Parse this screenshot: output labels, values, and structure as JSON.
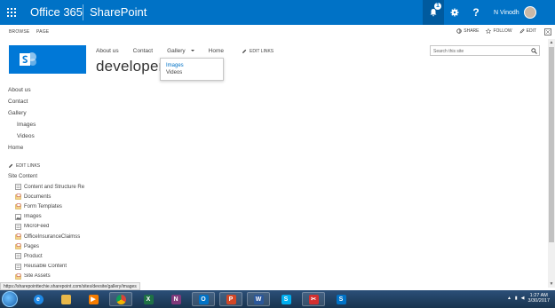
{
  "suitebar": {
    "brand": "Office 365",
    "app": "SharePoint",
    "notification_count": "1",
    "help_label": "?",
    "user_name": "N Vinodh"
  },
  "ribbon": {
    "tabs": [
      "BROWSE",
      "PAGE"
    ],
    "actions": [
      "SHARE",
      "FOLLOW",
      "EDIT"
    ]
  },
  "topnav": {
    "items": [
      "About us",
      "Contact",
      "Gallery",
      "Home"
    ],
    "edit_links": "EDIT LINKS"
  },
  "site_title": "developer",
  "search": {
    "placeholder": "Search this site"
  },
  "gallery_dropdown": {
    "items": [
      "Images",
      "Videos"
    ],
    "active": "Images"
  },
  "leftnav": {
    "items": [
      {
        "label": "About us",
        "level": 0
      },
      {
        "label": "Contact",
        "level": 0
      },
      {
        "label": "Gallery",
        "level": 0
      },
      {
        "label": "Images",
        "level": 1
      },
      {
        "label": "Videos",
        "level": 1
      },
      {
        "label": "Home",
        "level": 0
      }
    ],
    "edit_links": "EDIT LINKS",
    "site_content_label": "Site Content",
    "site_content": [
      {
        "label": "Content and Structure Re",
        "icon": "list-icon",
        "expandable": false
      },
      {
        "label": "Documents",
        "icon": "library-icon",
        "expandable": false
      },
      {
        "label": "Form Templates",
        "icon": "library-icon",
        "expandable": false
      },
      {
        "label": "Images",
        "icon": "image-library-icon",
        "expandable": false
      },
      {
        "label": "MicroFeed",
        "icon": "list-icon",
        "expandable": true
      },
      {
        "label": "OfficeInsuranceClaimss",
        "icon": "library-icon",
        "expandable": false
      },
      {
        "label": "Pages",
        "icon": "library-icon",
        "expandable": false
      },
      {
        "label": "Product",
        "icon": "list-icon",
        "expandable": false
      },
      {
        "label": "Reusable Content",
        "icon": "list-icon",
        "expandable": false
      },
      {
        "label": "Site Assets",
        "icon": "library-icon",
        "expandable": true
      }
    ]
  },
  "status_url": "https://sharepointtechie.sharepoint.com/sites/devsite/gallery/images",
  "taskbar": {
    "apps": [
      {
        "name": "ie-icon",
        "glyph": "e",
        "color": "#1e88e5",
        "open": false
      },
      {
        "name": "explorer-icon",
        "glyph": "",
        "color": "#e8b84a",
        "open": false
      },
      {
        "name": "media-player-icon",
        "glyph": "▶",
        "color": "#f57c00",
        "open": false
      },
      {
        "name": "chrome-icon",
        "glyph": "",
        "color": "#db4437",
        "open": true
      },
      {
        "name": "excel-icon",
        "glyph": "X",
        "color": "#1e7145",
        "open": false
      },
      {
        "name": "onenote-icon",
        "glyph": "N",
        "color": "#80397b",
        "open": false
      },
      {
        "name": "outlook-icon",
        "glyph": "O",
        "color": "#0072c6",
        "open": true
      },
      {
        "name": "powerpoint-icon",
        "glyph": "P",
        "color": "#d24726",
        "open": true
      },
      {
        "name": "word-icon",
        "glyph": "W",
        "color": "#2b579a",
        "open": true
      },
      {
        "name": "skype-icon",
        "glyph": "S",
        "color": "#00aff0",
        "open": false
      },
      {
        "name": "snipping-tool-icon",
        "glyph": "✂",
        "color": "#d32f2f",
        "open": true
      },
      {
        "name": "sharepoint-designer-icon",
        "glyph": "S",
        "color": "#0072c6",
        "open": false
      }
    ],
    "time": "1:27 AM",
    "date": "3/30/2017"
  }
}
